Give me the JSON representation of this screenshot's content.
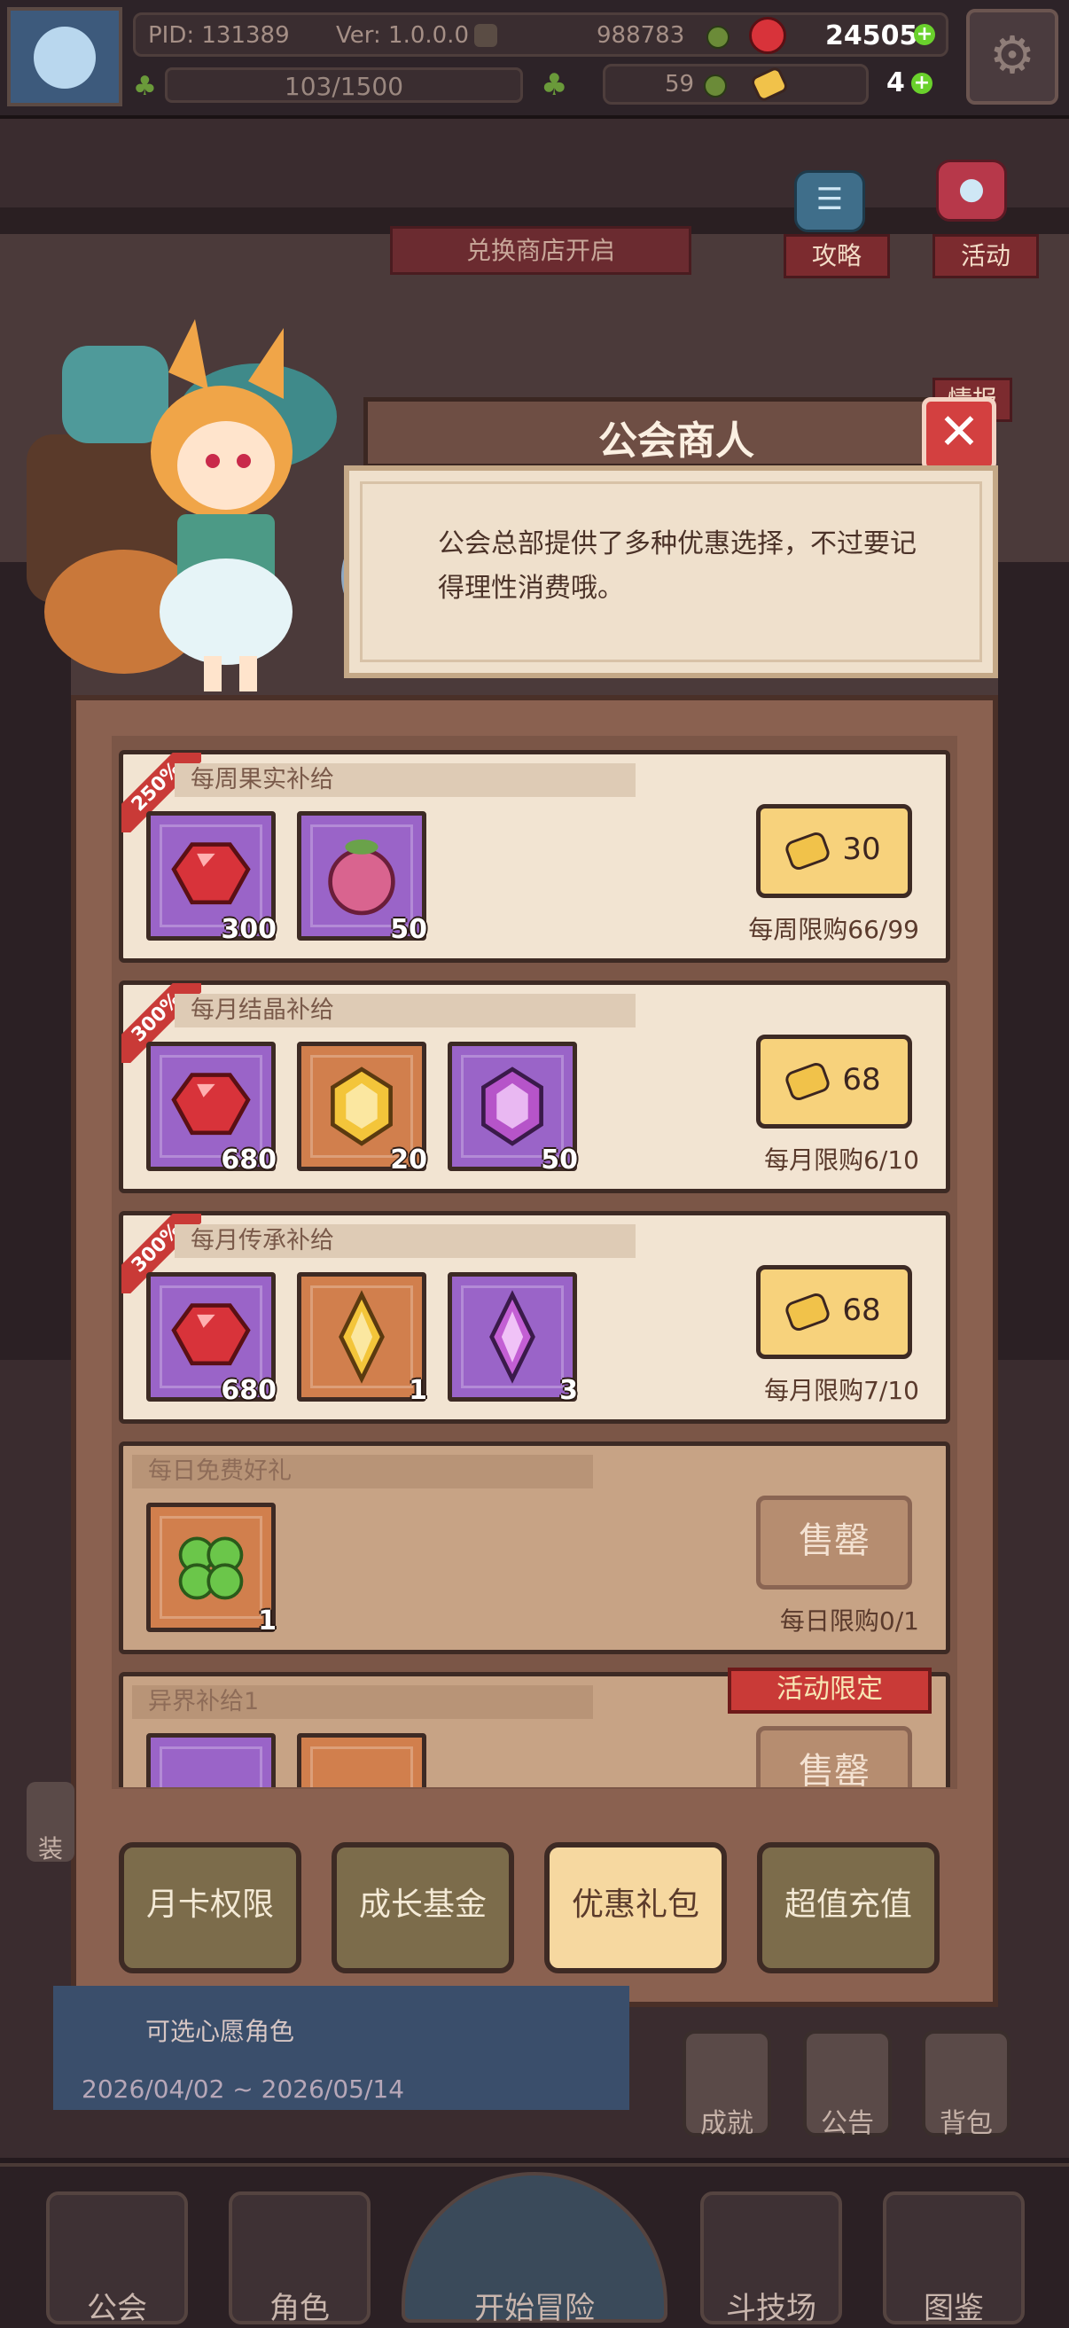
{
  "status": {
    "pid": "PID: 131389",
    "version": "Ver: 1.0.0.0",
    "gold": "988783",
    "gems": "24505",
    "stamina": "103/1500",
    "clover": "59",
    "ticket": "4"
  },
  "scene": {
    "banner": "兑换商店开启",
    "guide_label": "攻略",
    "event_label": "活动",
    "partial_label": "情报",
    "wish_text": "可选心愿角色",
    "date_range": "2026/04/02 ~ 2026/05/14",
    "side_equip": "装",
    "achievement": "成就",
    "notice": "公告",
    "bag": "背包"
  },
  "dialog": {
    "title": "公会商人",
    "message": "公会总部提供了多种优惠选择，不过要记得理性消费哦。"
  },
  "offers": [
    {
      "ribbon": "250%",
      "name": "每周果实补给",
      "price": "30",
      "limit": "每周限购66/99",
      "items": [
        {
          "icon": "red-gem-icon",
          "qty": "300"
        },
        {
          "icon": "fruit-icon",
          "qty": "50"
        }
      ]
    },
    {
      "ribbon": "300%",
      "name": "每月结晶补给",
      "price": "68",
      "limit": "每月限购6/10",
      "items": [
        {
          "icon": "red-gem-icon",
          "qty": "680"
        },
        {
          "icon": "gold-crystal-icon",
          "qty": "20"
        },
        {
          "icon": "purple-crystal-icon",
          "qty": "50"
        }
      ]
    },
    {
      "ribbon": "300%",
      "name": "每月传承补给",
      "price": "68",
      "limit": "每月限购7/10",
      "items": [
        {
          "icon": "red-gem-icon",
          "qty": "680"
        },
        {
          "icon": "gold-shard-icon",
          "qty": "1"
        },
        {
          "icon": "purple-shard-icon",
          "qty": "3"
        }
      ]
    },
    {
      "name": "每日免费好礼",
      "sold": "售罄",
      "limit": "每日限购0/1",
      "items": [
        {
          "icon": "clover-icon",
          "qty": "1"
        }
      ]
    },
    {
      "name": "异界补给1",
      "sold": "售罄",
      "badge": "活动限定"
    }
  ],
  "tabs": [
    "月卡权限",
    "成长基金",
    "优惠礼包",
    "超值充值"
  ],
  "active_tab": "优惠礼包",
  "nav": [
    "公会",
    "角色",
    "开始冒险",
    "斗技场",
    "图鉴"
  ],
  "colors": {
    "accent": "#c93a37",
    "button": "#f7d27c",
    "card": "#f2e4d2",
    "panel": "#8a6150"
  }
}
